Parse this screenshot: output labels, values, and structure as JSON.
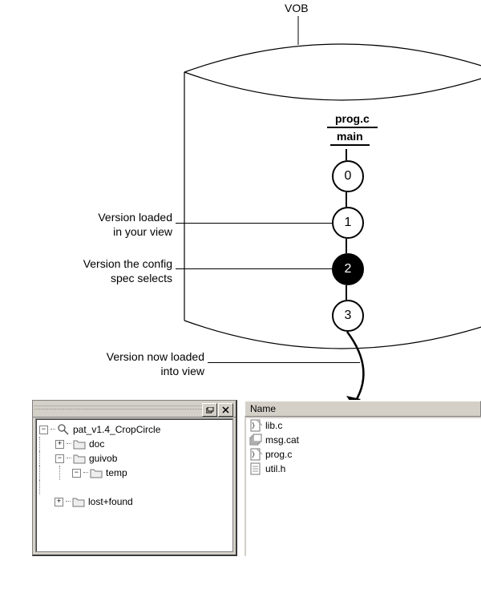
{
  "diagram": {
    "vob_label": "VOB",
    "file_label": "prog.c",
    "branch_label": "main",
    "versions": [
      "0",
      "1",
      "2",
      "3"
    ],
    "selected_version_index": 2,
    "callouts": {
      "view_loaded": "Version loaded\nin your view",
      "config_selects": "Version the config\nspec selects",
      "now_loaded": "Version now loaded\ninto view"
    }
  },
  "ui": {
    "name_column": "Name",
    "tree": {
      "root": "pat_v1.4_CropCircle",
      "children": [
        {
          "label": "doc",
          "expanded": false
        },
        {
          "label": "guivob",
          "expanded": true,
          "children": [
            {
              "label": "temp",
              "expanded": false
            }
          ]
        },
        {
          "label": "lost+found",
          "expanded": false
        }
      ]
    },
    "files": [
      {
        "name": "lib.c",
        "icon": "c-file"
      },
      {
        "name": "msg.cat",
        "icon": "stack-file"
      },
      {
        "name": "prog.c",
        "icon": "c-file"
      },
      {
        "name": "util.h",
        "icon": "h-file"
      }
    ]
  }
}
